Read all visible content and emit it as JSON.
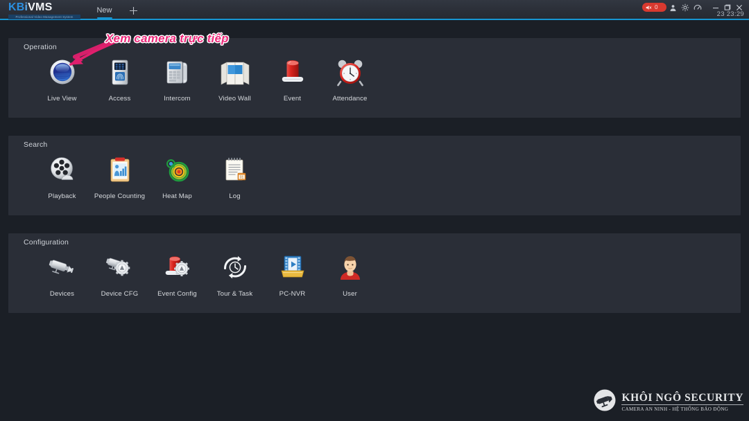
{
  "window": {
    "logo_kb": "KB",
    "logo_i": "i",
    "logo_vms": "VMS",
    "logo_tagline": "Professional Video Management System",
    "tab_label": "New",
    "add_tab_label": "+",
    "alarm_count": "0",
    "clock": "23 23:29",
    "accent_color": "#1796d3",
    "alarm_color": "#d8392f"
  },
  "titlebar_icons": [
    {
      "name": "mute-icon",
      "glyph": "speaker"
    },
    {
      "name": "user-icon",
      "glyph": "person"
    },
    {
      "name": "gear-icon",
      "glyph": "gear"
    },
    {
      "name": "dashboard-icon",
      "glyph": "gauge"
    },
    {
      "name": "minimize-button",
      "glyph": "minimize"
    },
    {
      "name": "maximize-button",
      "glyph": "maximize"
    },
    {
      "name": "close-button",
      "glyph": "close"
    }
  ],
  "sections": [
    {
      "title": "Operation",
      "items": [
        {
          "label": "Live View",
          "icon": "live-view-icon"
        },
        {
          "label": "Access",
          "icon": "access-control-icon"
        },
        {
          "label": "Intercom",
          "icon": "intercom-phone-icon"
        },
        {
          "label": "Video Wall",
          "icon": "video-wall-icon"
        },
        {
          "label": "Event",
          "icon": "alarm-light-icon"
        },
        {
          "label": "Attendance",
          "icon": "alarm-clock-icon"
        }
      ]
    },
    {
      "title": "Search",
      "items": [
        {
          "label": "Playback",
          "icon": "film-reel-icon"
        },
        {
          "label": "People Counting",
          "icon": "clipboard-chart-icon"
        },
        {
          "label": "Heat Map",
          "icon": "heat-map-icon"
        },
        {
          "label": "Log",
          "icon": "log-notepad-icon"
        }
      ]
    },
    {
      "title": "Configuration",
      "items": [
        {
          "label": "Devices",
          "icon": "camera-icon"
        },
        {
          "label": "Device CFG",
          "icon": "camera-gear-icon"
        },
        {
          "label": "Event Config",
          "icon": "alarm-gear-icon"
        },
        {
          "label": "Tour & Task",
          "icon": "tour-task-icon"
        },
        {
          "label": "PC-NVR",
          "icon": "pc-nvr-icon"
        },
        {
          "label": "User",
          "icon": "user-avatar-icon"
        }
      ]
    }
  ],
  "annotation": {
    "text": "Xem camera trực tiếp",
    "color": "#ec2a7b",
    "arrow_target": "Live View"
  },
  "watermark": {
    "title": "KHÔI  NGÔ SECURITY",
    "subtitle": "CAMERA AN NINH - HỆ THỐNG BÁO ĐỘNG",
    "logo_icon": "cctv-camera-logo-icon"
  }
}
